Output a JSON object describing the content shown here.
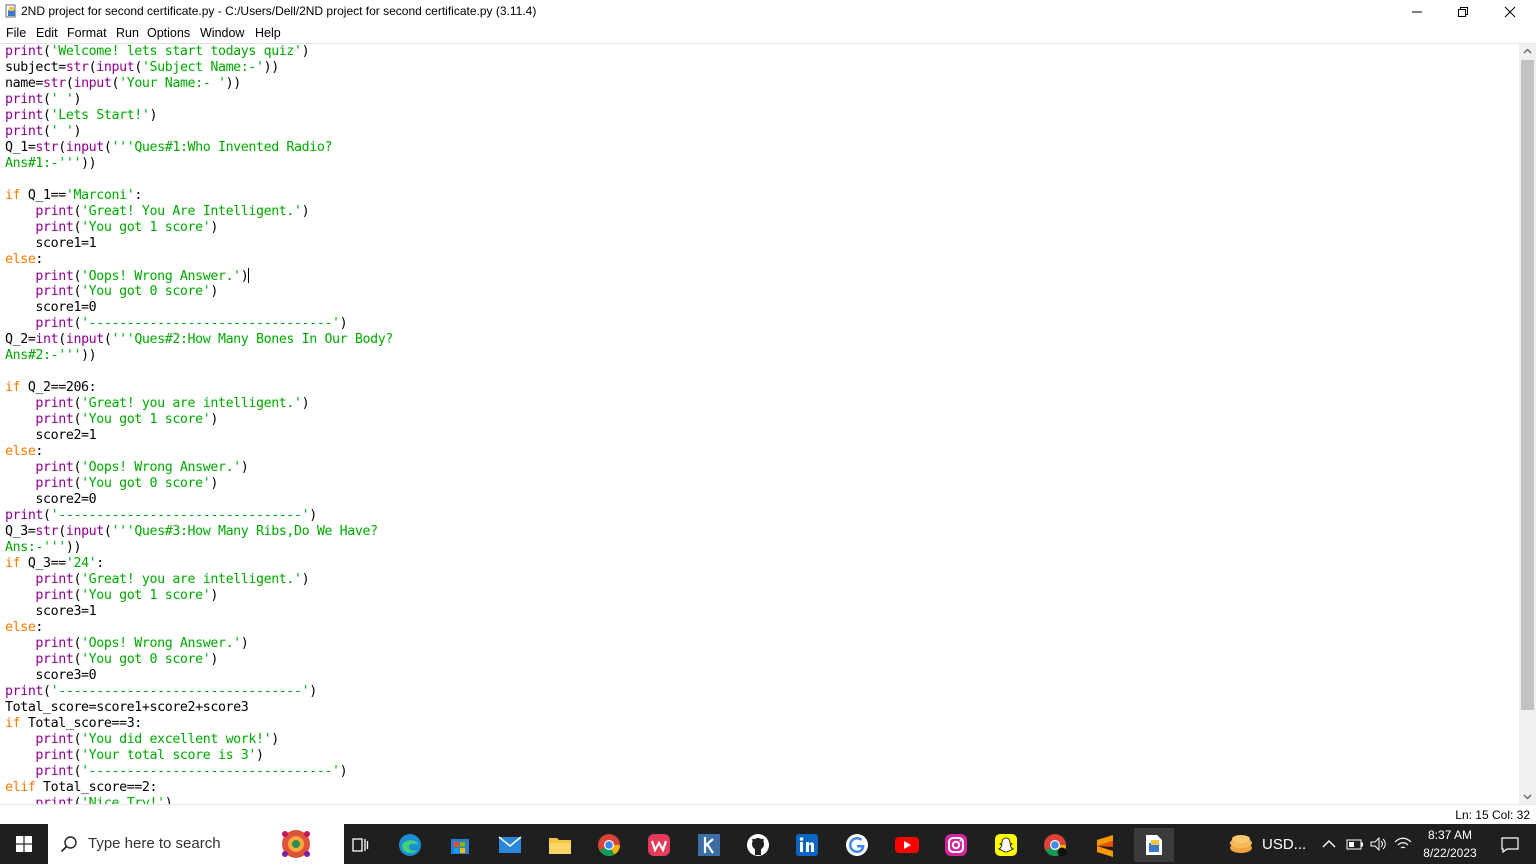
{
  "window": {
    "title": "2ND project for second certificate.py - C:/Users/Dell/2ND project for second certificate.py (3.11.4)"
  },
  "menu": [
    "File",
    "Edit",
    "Format",
    "Run",
    "Options",
    "Window",
    "Help"
  ],
  "code_lines": [
    [
      [
        "bi",
        "print"
      ],
      [
        "",
        "("
      ],
      [
        "st",
        "'Welcome! lets start todays quiz'"
      ],
      [
        "",
        ")"
      ]
    ],
    [
      [
        "",
        "subject="
      ],
      [
        "bi",
        "str"
      ],
      [
        "",
        "("
      ],
      [
        "bi",
        "input"
      ],
      [
        "",
        "("
      ],
      [
        "st",
        "'Subject Name:-'"
      ],
      [
        "",
        "))"
      ]
    ],
    [
      [
        "",
        "name="
      ],
      [
        "bi",
        "str"
      ],
      [
        "",
        "("
      ],
      [
        "bi",
        "input"
      ],
      [
        "",
        "("
      ],
      [
        "st",
        "'Your Name:- '"
      ],
      [
        "",
        "))"
      ]
    ],
    [
      [
        "bi",
        "print"
      ],
      [
        "",
        "("
      ],
      [
        "st",
        "' '"
      ],
      [
        "",
        ")"
      ]
    ],
    [
      [
        "bi",
        "print"
      ],
      [
        "",
        "("
      ],
      [
        "st",
        "'Lets Start!'"
      ],
      [
        "",
        ")"
      ]
    ],
    [
      [
        "bi",
        "print"
      ],
      [
        "",
        "("
      ],
      [
        "st",
        "' '"
      ],
      [
        "",
        ")"
      ]
    ],
    [
      [
        "",
        "Q_1="
      ],
      [
        "bi",
        "str"
      ],
      [
        "",
        "("
      ],
      [
        "bi",
        "input"
      ],
      [
        "",
        "("
      ],
      [
        "st",
        "'''Ques#1:Who Invented Radio?"
      ]
    ],
    [
      [
        "st",
        "Ans#1:-'''"
      ],
      [
        "",
        "))"
      ]
    ],
    [],
    [
      [
        "kw",
        "if"
      ],
      [
        "",
        " Q_1=="
      ],
      [
        "st",
        "'Marconi'"
      ],
      [
        "",
        ":"
      ]
    ],
    [
      [
        "",
        "    "
      ],
      [
        "bi",
        "print"
      ],
      [
        "",
        "("
      ],
      [
        "st",
        "'Great! You Are Intelligent.'"
      ],
      [
        "",
        ")"
      ]
    ],
    [
      [
        "",
        "    "
      ],
      [
        "bi",
        "print"
      ],
      [
        "",
        "("
      ],
      [
        "st",
        "'You got 1 score'"
      ],
      [
        "",
        ")"
      ]
    ],
    [
      [
        "",
        "    score1=1"
      ]
    ],
    [
      [
        "kw",
        "else"
      ],
      [
        "",
        ":"
      ]
    ],
    [
      [
        "",
        "    "
      ],
      [
        "bi",
        "print"
      ],
      [
        "",
        "("
      ],
      [
        "st",
        "'Oops! Wrong Answer.'"
      ],
      [
        "",
        ")"
      ],
      [
        "caret",
        ""
      ]
    ],
    [
      [
        "",
        "    "
      ],
      [
        "bi",
        "print"
      ],
      [
        "",
        "("
      ],
      [
        "st",
        "'You got 0 score'"
      ],
      [
        "",
        ")"
      ]
    ],
    [
      [
        "",
        "    score1=0"
      ]
    ],
    [
      [
        "",
        "    "
      ],
      [
        "bi",
        "print"
      ],
      [
        "",
        "("
      ],
      [
        "st",
        "'--------------------------------'"
      ],
      [
        "",
        ")"
      ]
    ],
    [
      [
        "",
        "Q_2="
      ],
      [
        "bi",
        "int"
      ],
      [
        "",
        "("
      ],
      [
        "bi",
        "input"
      ],
      [
        "",
        "("
      ],
      [
        "st",
        "'''Ques#2:How Many Bones In Our Body?"
      ]
    ],
    [
      [
        "st",
        "Ans#2:-'''"
      ],
      [
        "",
        "))"
      ]
    ],
    [],
    [
      [
        "kw",
        "if"
      ],
      [
        "",
        " Q_2==206:"
      ]
    ],
    [
      [
        "",
        "    "
      ],
      [
        "bi",
        "print"
      ],
      [
        "",
        "("
      ],
      [
        "st",
        "'Great! you are intelligent.'"
      ],
      [
        "",
        ")"
      ]
    ],
    [
      [
        "",
        "    "
      ],
      [
        "bi",
        "print"
      ],
      [
        "",
        "("
      ],
      [
        "st",
        "'You got 1 score'"
      ],
      [
        "",
        ")"
      ]
    ],
    [
      [
        "",
        "    score2=1"
      ]
    ],
    [
      [
        "kw",
        "else"
      ],
      [
        "",
        ":"
      ]
    ],
    [
      [
        "",
        "    "
      ],
      [
        "bi",
        "print"
      ],
      [
        "",
        "("
      ],
      [
        "st",
        "'Oops! Wrong Answer.'"
      ],
      [
        "",
        ")"
      ]
    ],
    [
      [
        "",
        "    "
      ],
      [
        "bi",
        "print"
      ],
      [
        "",
        "("
      ],
      [
        "st",
        "'You got 0 score'"
      ],
      [
        "",
        ")"
      ]
    ],
    [
      [
        "",
        "    score2=0"
      ]
    ],
    [
      [
        "bi",
        "print"
      ],
      [
        "",
        "("
      ],
      [
        "st",
        "'--------------------------------'"
      ],
      [
        "",
        ")"
      ]
    ],
    [
      [
        "",
        "Q_3="
      ],
      [
        "bi",
        "str"
      ],
      [
        "",
        "("
      ],
      [
        "bi",
        "input"
      ],
      [
        "",
        "("
      ],
      [
        "st",
        "'''Ques#3:How Many Ribs,Do We Have?"
      ]
    ],
    [
      [
        "st",
        "Ans:-'''"
      ],
      [
        "",
        "))"
      ]
    ],
    [
      [
        "kw",
        "if"
      ],
      [
        "",
        " Q_3=="
      ],
      [
        "st",
        "'24'"
      ],
      [
        "",
        ":"
      ]
    ],
    [
      [
        "",
        "    "
      ],
      [
        "bi",
        "print"
      ],
      [
        "",
        "("
      ],
      [
        "st",
        "'Great! you are intelligent.'"
      ],
      [
        "",
        ")"
      ]
    ],
    [
      [
        "",
        "    "
      ],
      [
        "bi",
        "print"
      ],
      [
        "",
        "("
      ],
      [
        "st",
        "'You got 1 score'"
      ],
      [
        "",
        ")"
      ]
    ],
    [
      [
        "",
        "    score3=1"
      ]
    ],
    [
      [
        "kw",
        "else"
      ],
      [
        "",
        ":"
      ]
    ],
    [
      [
        "",
        "    "
      ],
      [
        "bi",
        "print"
      ],
      [
        "",
        "("
      ],
      [
        "st",
        "'Oops! Wrong Answer.'"
      ],
      [
        "",
        ")"
      ]
    ],
    [
      [
        "",
        "    "
      ],
      [
        "bi",
        "print"
      ],
      [
        "",
        "("
      ],
      [
        "st",
        "'You got 0 score'"
      ],
      [
        "",
        ")"
      ]
    ],
    [
      [
        "",
        "    score3=0"
      ]
    ],
    [
      [
        "bi",
        "print"
      ],
      [
        "",
        "("
      ],
      [
        "st",
        "'--------------------------------'"
      ],
      [
        "",
        ")"
      ]
    ],
    [
      [
        "",
        "Total_score=score1+score2+score3"
      ]
    ],
    [
      [
        "kw",
        "if"
      ],
      [
        "",
        " Total_score==3:"
      ]
    ],
    [
      [
        "",
        "    "
      ],
      [
        "bi",
        "print"
      ],
      [
        "",
        "("
      ],
      [
        "st",
        "'You did excellent work!'"
      ],
      [
        "",
        ")"
      ]
    ],
    [
      [
        "",
        "    "
      ],
      [
        "bi",
        "print"
      ],
      [
        "",
        "("
      ],
      [
        "st",
        "'Your total score is 3'"
      ],
      [
        "",
        ")"
      ]
    ],
    [
      [
        "",
        "    "
      ],
      [
        "bi",
        "print"
      ],
      [
        "",
        "("
      ],
      [
        "st",
        "'--------------------------------'"
      ],
      [
        "",
        ")"
      ]
    ],
    [
      [
        "kw",
        "elif"
      ],
      [
        "",
        " Total_score==2:"
      ]
    ],
    [
      [
        "",
        "    "
      ],
      [
        "bi",
        "print"
      ],
      [
        "",
        "("
      ],
      [
        "st",
        "'Nice Try!'"
      ],
      [
        "",
        ")"
      ]
    ]
  ],
  "status": {
    "position": "Ln: 15   Col: 32"
  },
  "taskbar": {
    "search_placeholder": "Type here to search",
    "tray_label": "USD...",
    "time": "8:37 AM",
    "date": "8/22/2023"
  },
  "colors": {
    "keyword": "#ff7700",
    "builtin": "#900090",
    "string": "#00aa00",
    "taskbar": "#1f1f1f"
  }
}
